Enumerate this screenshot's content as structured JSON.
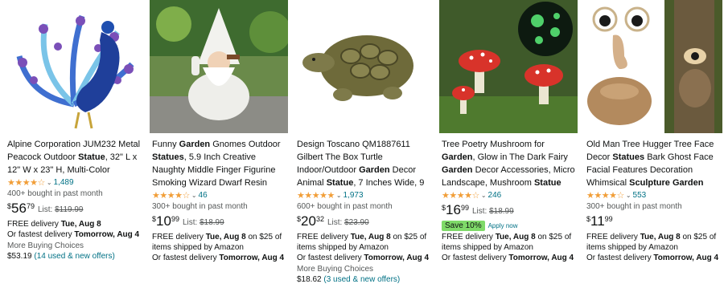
{
  "colors": {
    "link": "#007185",
    "star": "#f19e38",
    "muted": "#565959",
    "save_badge": "#7fda69"
  },
  "products": [
    {
      "image": "peacock-statue",
      "title_parts": [
        {
          "t": "Alpine Corporation JUM232 Metal Peacock Outdoor ",
          "b": false
        },
        {
          "t": "Statue",
          "b": true
        },
        {
          "t": ", 32\" L x 12\" W x 23\" H, Multi-Color",
          "b": false
        }
      ],
      "stars_text": "★★★★☆",
      "rating_count": "1,489",
      "bought": "400+ bought in past month",
      "price": {
        "currency": "$",
        "whole": "56",
        "fraction": "79"
      },
      "list_label": "List: ",
      "list_price": "$119.99",
      "delivery_prefix": "FREE delivery ",
      "delivery_date": "Tue, Aug 8",
      "fastest_prefix": "Or fastest delivery ",
      "fastest_date": "Tomorrow, Aug 4",
      "more_label": "More Buying Choices",
      "offer_price": "$53.19",
      "offer_link": "(14 used & new offers)"
    },
    {
      "image": "gnome-statue",
      "title_parts": [
        {
          "t": "Funny ",
          "b": false
        },
        {
          "t": "Garden",
          "b": true
        },
        {
          "t": " Gnomes Outdoor ",
          "b": false
        },
        {
          "t": "Statues",
          "b": true
        },
        {
          "t": ", 5.9 Inch Creative Naughty Middle Finger Figurine Smoking Wizard Dwarf Resin ",
          "b": false
        },
        {
          "t": "Sculpture",
          "b": true
        },
        {
          "t": "...",
          "b": false
        }
      ],
      "stars_text": "★★★★☆",
      "rating_count": "46",
      "bought": "300+ bought in past month",
      "price": {
        "currency": "$",
        "whole": "10",
        "fraction": "99"
      },
      "list_label": "List: ",
      "list_price": "$18.99",
      "delivery_prefix": "FREE delivery ",
      "delivery_date": "Tue, Aug 8",
      "delivery_suffix": " on $25 of items shipped by Amazon",
      "fastest_prefix": "Or fastest delivery ",
      "fastest_date": "Tomorrow, Aug 4"
    },
    {
      "image": "turtle-statue",
      "title_parts": [
        {
          "t": "Design Toscano QM1887611 Gilbert The Box Turtle Indoor/Outdoor ",
          "b": false
        },
        {
          "t": "Garden",
          "b": true
        },
        {
          "t": " Decor Animal ",
          "b": false
        },
        {
          "t": "Statue",
          "b": true
        },
        {
          "t": ", 7 Inches Wide, 9 Inches Deep, 3 Inche...",
          "b": false
        }
      ],
      "stars_text": "★★★★★",
      "rating_count": "1,973",
      "bought": "600+ bought in past month",
      "price": {
        "currency": "$",
        "whole": "20",
        "fraction": "32"
      },
      "list_label": "List: ",
      "list_price": "$23.90",
      "delivery_prefix": "FREE delivery ",
      "delivery_date": "Tue, Aug 8",
      "delivery_suffix": " on $25 of items shipped by Amazon",
      "fastest_prefix": "Or fastest delivery ",
      "fastest_date": "Tomorrow, Aug 4",
      "more_label": "More Buying Choices",
      "offer_price": "$18.62",
      "offer_link": "(3 used & new offers)"
    },
    {
      "image": "mushroom-statue",
      "title_parts": [
        {
          "t": "Tree Poetry Mushroom for ",
          "b": false
        },
        {
          "t": "Garden",
          "b": true
        },
        {
          "t": ", Glow in The Dark Fairy ",
          "b": false
        },
        {
          "t": "Garden",
          "b": true
        },
        {
          "t": " Decor Accessories, Micro Landscape, Mushroom ",
          "b": false
        },
        {
          "t": "Statue",
          "b": true
        }
      ],
      "stars_text": "★★★★☆",
      "rating_count": "246",
      "price": {
        "currency": "$",
        "whole": "16",
        "fraction": "99"
      },
      "list_label": "List: ",
      "list_price": "$18.99",
      "save_badge": "Save 10%",
      "apply_now": "Apply now",
      "delivery_prefix": "FREE delivery ",
      "delivery_date": "Tue, Aug 8",
      "delivery_suffix": " on $25 of items shipped by Amazon",
      "fastest_prefix": "Or fastest delivery ",
      "fastest_date": "Tomorrow, Aug 4"
    },
    {
      "image": "tree-face-statue",
      "title_parts": [
        {
          "t": "Old Man Tree Hugger Tree Face Decor ",
          "b": false
        },
        {
          "t": "Statues",
          "b": true
        },
        {
          "t": " Bark Ghost Face Facial Features Decoration Whimsical ",
          "b": false
        },
        {
          "t": "Sculpture Garden",
          "b": true
        },
        {
          "t": " Peeker Tree Face...",
          "b": false
        }
      ],
      "stars_text": "★★★★☆",
      "rating_count": "553",
      "bought": "300+ bought in past month",
      "price": {
        "currency": "$",
        "whole": "11",
        "fraction": "99"
      },
      "delivery_prefix": "FREE delivery ",
      "delivery_date": "Tue, Aug 8",
      "delivery_suffix": " on $25 of items shipped by Amazon",
      "fastest_prefix": "Or fastest delivery ",
      "fastest_date": "Tomorrow, Aug 4"
    }
  ]
}
